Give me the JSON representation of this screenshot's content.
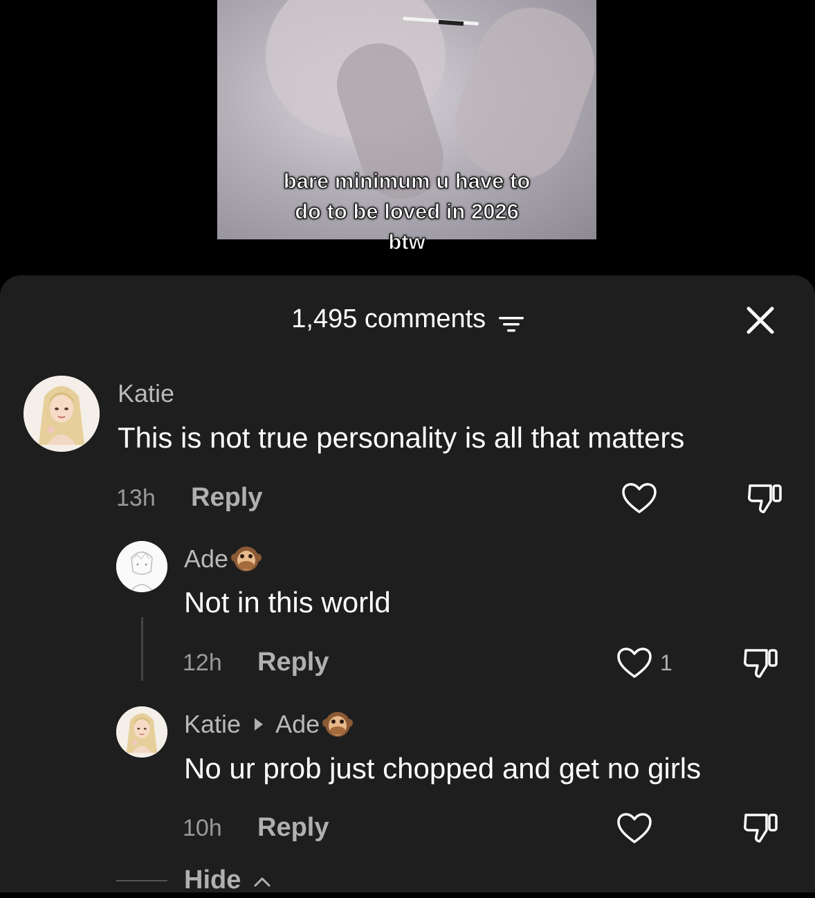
{
  "video": {
    "caption_lines": [
      "bare minimum u have to",
      "do to be loved in 2026",
      "btw"
    ]
  },
  "comments_panel": {
    "count_label": "1,495 comments",
    "filter_icon": "filter-icon",
    "close_icon": "close-icon"
  },
  "comments": [
    {
      "username": "Katie",
      "text": "This is not true personality is all that matters",
      "time": "13h",
      "reply_label": "Reply",
      "like_count": "",
      "avatar_icon": "avatar-doll"
    },
    {
      "username": "Ade",
      "username_emoji": "🙊",
      "text": "Not in this world",
      "time": "12h",
      "reply_label": "Reply",
      "like_count": "1",
      "avatar_icon": "avatar-sketch"
    },
    {
      "username": "Katie",
      "reply_to": "Ade",
      "reply_to_emoji": "🙊",
      "text": "No ur prob just chopped and get no girls",
      "time": "10h",
      "reply_label": "Reply",
      "like_count": "",
      "avatar_icon": "avatar-doll"
    }
  ],
  "hide": {
    "label": "Hide"
  },
  "colors": {
    "sheet_bg": "#1e1e1e",
    "text_primary": "#ffffff",
    "text_secondary": "#b9b9b9"
  }
}
